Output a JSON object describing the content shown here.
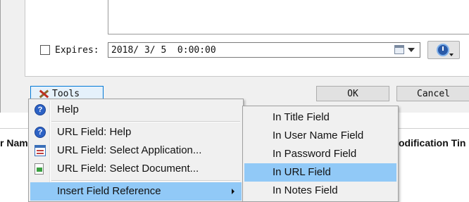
{
  "expires": {
    "label": "Expires:",
    "value": "2018/ 3/ 5  0:00:00"
  },
  "buttons": {
    "tools": "Tools",
    "ok": "OK",
    "cancel": "Cancel"
  },
  "list_headers": {
    "left": "r Nam",
    "right": "odification Tin"
  },
  "tools_menu": {
    "items": [
      {
        "label": "Help",
        "icon": "help-icon"
      },
      {
        "label": "URL Field: Help",
        "icon": "help-icon"
      },
      {
        "label": "URL Field: Select Application...",
        "icon": "application-icon"
      },
      {
        "label": "URL Field: Select Document...",
        "icon": "document-icon"
      },
      {
        "label": "Insert Field Reference",
        "icon": "",
        "has_submenu": true,
        "highlighted": true
      }
    ]
  },
  "field_reference_submenu": {
    "items": [
      {
        "label": "In Title Field"
      },
      {
        "label": "In User Name Field"
      },
      {
        "label": "In Password Field"
      },
      {
        "label": "In URL Field",
        "highlighted": true
      },
      {
        "label": "In Notes Field"
      }
    ]
  },
  "colors": {
    "highlight": "#91c9f7",
    "menu_bg": "#f0f0f0",
    "focus_border": "#0078d7"
  }
}
